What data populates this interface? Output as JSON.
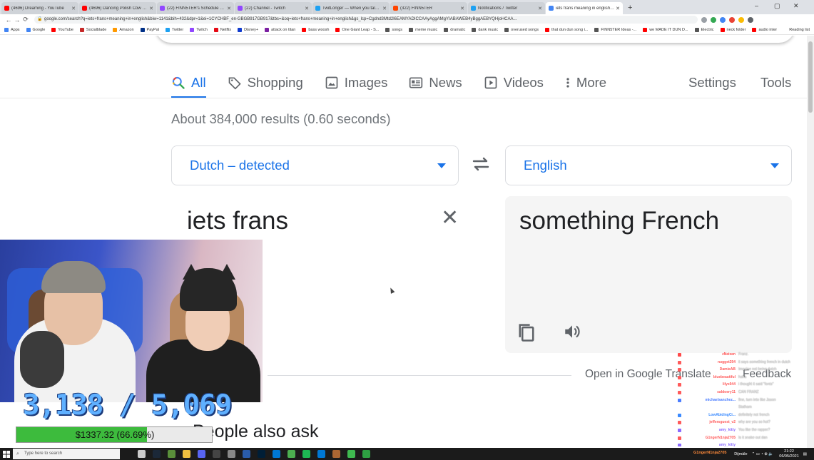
{
  "browser": {
    "tabs": [
      {
        "title": "(4696) Dreaming - YouTube",
        "color": "#ff0000",
        "active": false
      },
      {
        "title": "(4696) Dancing Polish Cow 10 H...",
        "color": "#ff0000",
        "active": false
      },
      {
        "title": "(22) FINN5TER's Schedule - Twit...",
        "color": "#9146ff",
        "active": false
      },
      {
        "title": "(22) Channel - Twitch",
        "color": "#9146ff",
        "active": false
      },
      {
        "title": "TwitLonger — When you talk to...",
        "color": "#1da1f2",
        "active": false
      },
      {
        "title": "(322) FINN5TER",
        "color": "#ff4500",
        "active": false
      },
      {
        "title": "Notifications / Twitter",
        "color": "#1da1f2",
        "active": false
      },
      {
        "title": "iets frans meaning in english - G...",
        "color": "#4285f4",
        "active": true
      }
    ],
    "new_tab_label": "+",
    "url": "google.com/search?q=iets+frans+meaning+in+english&biw=1141&bih=432&dpr=1&ei=1CYCHBF_en-GBGB917GB917&tbs=&oq=iets+frans+meaning+in+english&gs_lcp=Cgdnd3Mtd2l6EAMYADICCAAyAggAMgYIABAWEB4yBggAEBYQHjoHCAA...",
    "nav": {
      "back": "←",
      "forward": "→",
      "reload": "⟳",
      "lock": "🔒"
    },
    "window": {
      "minimize": "–",
      "maximize": "▢",
      "close": "✕"
    },
    "bookmarks": [
      {
        "label": "Apps",
        "color": "#4285f4"
      },
      {
        "label": "Google",
        "color": "#4285f4"
      },
      {
        "label": "YouTube",
        "color": "#ff0000"
      },
      {
        "label": "Socialblade",
        "color": "#c62828"
      },
      {
        "label": "Amazon",
        "color": "#ff9900"
      },
      {
        "label": "PayPal",
        "color": "#003087"
      },
      {
        "label": "Twitter",
        "color": "#1da1f2"
      },
      {
        "label": "Twitch",
        "color": "#9146ff"
      },
      {
        "label": "Netflix",
        "color": "#e50914"
      },
      {
        "label": "Disney+",
        "color": "#113ccf"
      },
      {
        "label": "attack on titan",
        "color": "#7b1fa2"
      },
      {
        "label": "bass woosh",
        "color": "#ff0000"
      },
      {
        "label": "One Giant Leap - S...",
        "color": "#ff0000"
      },
      {
        "label": "songs",
        "color": "#555555"
      },
      {
        "label": "meme music",
        "color": "#555555"
      },
      {
        "label": "dramatic",
        "color": "#555555"
      },
      {
        "label": "dank music",
        "color": "#555555"
      },
      {
        "label": "overused songs",
        "color": "#555555"
      },
      {
        "label": "that dun dun song i...",
        "color": "#ff0000"
      },
      {
        "label": "FINN5TER Ideas -...",
        "color": "#555555"
      },
      {
        "label": "we MADE IT DUN D...",
        "color": "#ff0000"
      },
      {
        "label": "Electric",
        "color": "#555555"
      },
      {
        "label": "neck folder",
        "color": "#ff0000"
      },
      {
        "label": "audio inter",
        "color": "#ff0000"
      }
    ],
    "reading_list": "Reading list"
  },
  "google": {
    "tabs": [
      {
        "label": "All",
        "icon": "search-icon",
        "active": true
      },
      {
        "label": "Shopping",
        "icon": "tag-icon",
        "active": false
      },
      {
        "label": "Images",
        "icon": "image-icon",
        "active": false
      },
      {
        "label": "News",
        "icon": "news-icon",
        "active": false
      },
      {
        "label": "Videos",
        "icon": "play-icon",
        "active": false
      },
      {
        "label": "More",
        "icon": "more-vert-icon",
        "active": false
      }
    ],
    "settings_label": "Settings",
    "tools_label": "Tools",
    "results_stats": "About 384,000 results (0.60 seconds)",
    "accent": "#1a73e8"
  },
  "translate": {
    "source_lang": "Dutch – detected",
    "target_lang": "English",
    "swap_icon": "⇄",
    "source_text": "iets frans",
    "clear_icon": "✕",
    "target_text": "something French",
    "open_link": "Open in Google Translate",
    "feedback": "Feedback"
  },
  "people_also_ask": "People also ask",
  "stream": {
    "sub_goal": "3,138 / 5,069",
    "donation_text": "$1337.32 (66.69%)",
    "donation_progress": 0.6669,
    "donation_color": "#3dbb3d",
    "chat": [
      {
        "user": "zNeixen",
        "msg": "Franz.",
        "color": "#ff4a4a"
      },
      {
        "user": "nugget294",
        "msg": "it says something french in dutch",
        "color": "#ff5a5a"
      },
      {
        "user": "DamieAB",
        "msg": "Imagine not being dutch",
        "color": "#ff5a5a"
      },
      {
        "user": "bluebeautiful",
        "msg": "haha",
        "color": "#ff5a5a"
      },
      {
        "user": "lilys944",
        "msg": "i thought it said \"fonts\"",
        "color": "#ff5a5a"
      },
      {
        "user": "saldoery11",
        "msg": "CAN FRANZ",
        "color": "#ff5a5a"
      },
      {
        "user": "michaelsanchez...",
        "msg": "fine, turn into like Jason",
        "color": "#4a7dff"
      },
      {
        "user": "",
        "msg": "Statham",
        "color": "#4a7dff"
      },
      {
        "user": "LowAbidingCi...",
        "msg": "definitely not french",
        "color": "#3a8aff"
      },
      {
        "user": "jeffersguest_v2",
        "msg": "why are you so hot?",
        "color": "#ff5a5a"
      },
      {
        "user": "amy_kitty",
        "msg": "You like the rapper?",
        "color": "#8a6aff"
      },
      {
        "user": "G1ngerN1nja2705",
        "msg": "Is it snake out dan",
        "color": "#ff5a5a"
      },
      {
        "user": "amy_kitty",
        "msg": "",
        "color": "#8a6aff"
      }
    ]
  },
  "taskbar": {
    "search_placeholder": "Type here to search",
    "event": "G1ngerN1nja2705",
    "tray_label": "Dijmàle",
    "time": "21:22",
    "date": "06/05/2021",
    "icons": [
      {
        "name": "task-view-icon",
        "color": "#cccccc"
      },
      {
        "name": "steam-icon",
        "color": "#1b2838"
      },
      {
        "name": "minecraft-icon",
        "color": "#5a8f3a"
      },
      {
        "name": "files-icon",
        "color": "#f0c040"
      },
      {
        "name": "discord-icon",
        "color": "#5865f2"
      },
      {
        "name": "obs-icon",
        "color": "#444444"
      },
      {
        "name": "settings-icon",
        "color": "#888888"
      },
      {
        "name": "vegas-icon",
        "color": "#2a5caa"
      },
      {
        "name": "photoshop-icon",
        "color": "#001e36"
      },
      {
        "name": "windows-store-icon",
        "color": "#0078d4"
      },
      {
        "name": "chrome-icon",
        "color": "#4caf50"
      },
      {
        "name": "spotify-icon",
        "color": "#1db954"
      },
      {
        "name": "mail-icon",
        "color": "#0078d4"
      },
      {
        "name": "app-icon",
        "color": "#aa6633"
      },
      {
        "name": "app2-icon",
        "color": "#3fb950"
      },
      {
        "name": "app3-icon",
        "color": "#2ea043"
      }
    ]
  }
}
